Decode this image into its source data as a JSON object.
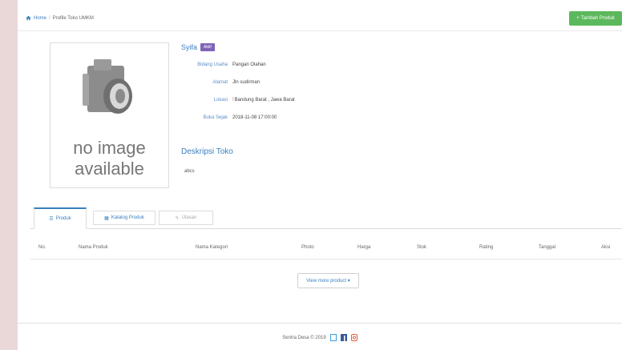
{
  "breadcrumb": {
    "home": "Home",
    "separator": "/",
    "current": "Profile Toko UMKM"
  },
  "header": {
    "add_button_label": "Tambah Produk"
  },
  "photo": {
    "line1": "no image",
    "line2": "available"
  },
  "profile": {
    "name": "Syifa",
    "badge": "Aktif",
    "fields": [
      {
        "label": "Bidang Usaha",
        "value": "Pangan Olahan"
      },
      {
        "label": "Alamat",
        "value": "Jln sudirman"
      },
      {
        "label": "Lokasi",
        "value": "Bandung Barat , Jawa Barat"
      },
      {
        "label": "Buka Sejak",
        "value": "2018-11-08 17:00:00"
      }
    ],
    "description_title": "Deskripsi Toko",
    "description_text": "abcs"
  },
  "tabs": [
    {
      "label": "Produk"
    },
    {
      "label": "Katalog Produk"
    },
    {
      "label": "Ulasan"
    }
  ],
  "table": {
    "columns": [
      "No.",
      "Nama Produk",
      "Nama Kategori",
      "Photo",
      "Harga",
      "Stok",
      "Rating",
      "Tanggal",
      "Aksi"
    ]
  },
  "view_more_label": "View more product",
  "footer": {
    "text": "Sentra Desa © 2019"
  },
  "colors": {
    "accent": "#3a7fc0",
    "success": "#5cb85c",
    "badge": "#7f63b8"
  }
}
